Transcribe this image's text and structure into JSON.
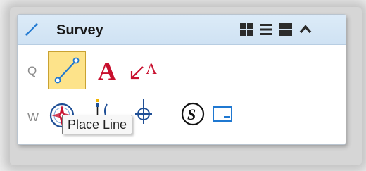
{
  "toolbox": {
    "title": "Survey",
    "rows": [
      {
        "label": "Q"
      },
      {
        "label": "W"
      }
    ],
    "selected_tool": "Place Line"
  },
  "tooltip": {
    "text": "Place Line"
  },
  "colors": {
    "header_bg": "#cfe2f3",
    "selected_bg": "#fde38a",
    "accent_red": "#c8102e",
    "accent_blue": "#1f78d1"
  },
  "icons": {
    "header": "survey-line-icon",
    "view_buttons": [
      "grid-view-icon",
      "list-view-icon",
      "large-view-icon",
      "collapse-icon"
    ],
    "row_q": [
      "place-line-icon",
      "text-icon",
      "place-note-icon"
    ],
    "row_w": [
      "compass-icon",
      "survey-point-icon",
      "target-icon",
      "s-symbol-icon",
      "window-icon"
    ]
  }
}
